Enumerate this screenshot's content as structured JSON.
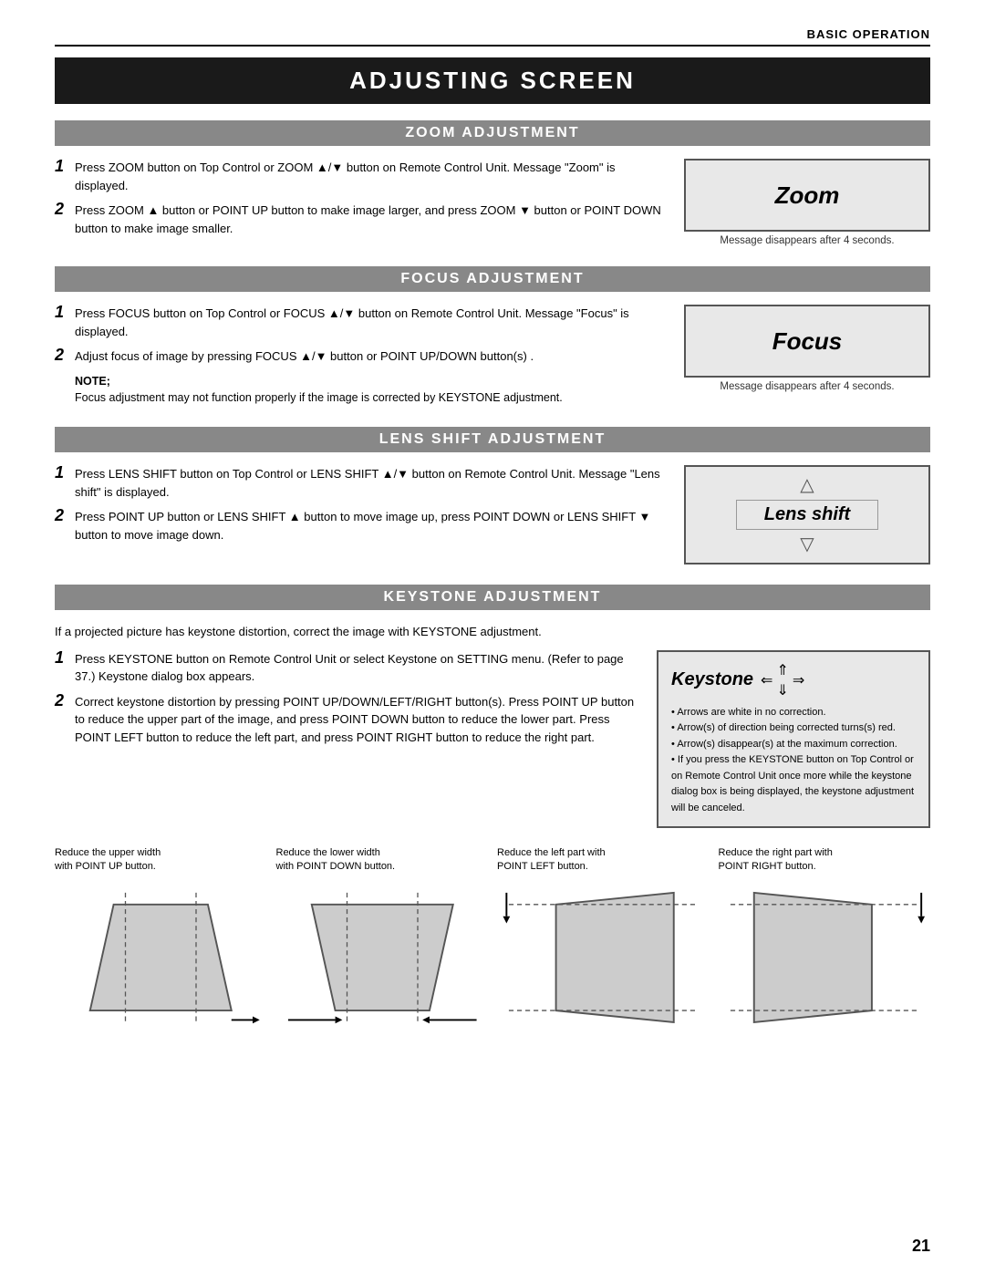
{
  "header": {
    "section": "Basic Operation"
  },
  "main_title": "Adjusting Screen",
  "sections": {
    "zoom": {
      "header": "Zoom Adjustment",
      "steps": [
        "Press ZOOM button on Top Control or ZOOM ▲/▼ button on Remote Control Unit.  Message \"Zoom\" is displayed.",
        "Press ZOOM ▲ button or POINT UP button to make image larger, and press ZOOM ▼ button or POINT DOWN button to make image smaller."
      ],
      "display_label": "Zoom",
      "caption": "Message disappears after 4 seconds."
    },
    "focus": {
      "header": "Focus Adjustment",
      "steps": [
        "Press FOCUS button on Top Control or FOCUS ▲/▼ button on Remote Control Unit.  Message \"Focus\" is displayed.",
        "Adjust focus of image by pressing FOCUS ▲/▼  button or POINT UP/DOWN button(s) ."
      ],
      "note_label": "NOTE;",
      "note_text": "Focus adjustment may not function properly if the image is corrected by KEYSTONE adjustment.",
      "display_label": "Focus",
      "caption": "Message disappears after 4 seconds."
    },
    "lens_shift": {
      "header": "Lens Shift Adjustment",
      "steps": [
        "Press LENS SHIFT button on Top Control or LENS SHIFT ▲/▼ button on Remote Control Unit.  Message \"Lens shift\" is displayed.",
        "Press POINT UP button or LENS SHIFT ▲ button to move image up, press POINT DOWN or LENS SHIFT ▼ button to move image down."
      ],
      "display_label": "Lens shift"
    },
    "keystone": {
      "header": "Keystone Adjustment",
      "intro": "If a projected picture has keystone distortion, correct the image with KEYSTONE adjustment.",
      "steps": [
        "Press KEYSTONE button on Remote Control Unit or select Keystone on SETTING menu.  (Refer to page 37.)  Keystone dialog box appears.",
        "Correct keystone distortion by pressing POINT UP/DOWN/LEFT/RIGHT button(s).  Press POINT UP button to reduce the upper part of the image, and press POINT DOWN button to reduce the lower part.  Press POINT LEFT button to reduce the left part, and press POINT RIGHT button to reduce the right part."
      ],
      "display_label": "Keystone",
      "bullets": [
        "Arrows are white in no correction.",
        "Arrow(s) of direction being corrected turns(s) red.",
        "Arrow(s) disappear(s) at the maximum correction.",
        "If you press the KEYSTONE button on Top Control or on Remote Control Unit once more while the keystone dialog box is being displayed, the keystone adjustment will be canceled."
      ],
      "diagrams": [
        {
          "caption_line1": "Reduce the upper width",
          "caption_line2": "with POINT UP button."
        },
        {
          "caption_line1": "Reduce the lower width",
          "caption_line2": "with POINT DOWN button."
        },
        {
          "caption_line1": "Reduce the left part with",
          "caption_line2": "POINT LEFT button."
        },
        {
          "caption_line1": "Reduce the right part with",
          "caption_line2": "POINT RIGHT button."
        }
      ]
    }
  },
  "page_number": "21"
}
